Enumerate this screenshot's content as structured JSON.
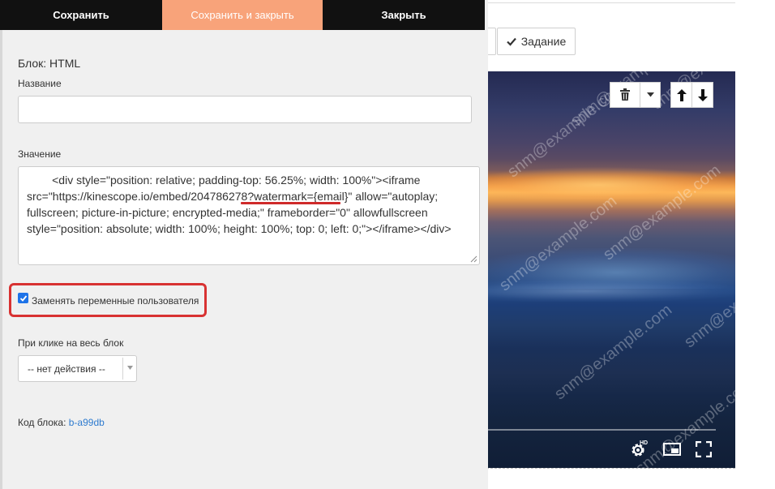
{
  "toolbar": {
    "save_label": "Сохранить",
    "save_close_label": "Сохранить и закрыть",
    "close_label": "Закрыть"
  },
  "block_editor": {
    "block_title": "Блок: HTML",
    "name_label": "Название",
    "name_value": "",
    "value_label": "Значение",
    "value_text": "        <div style=\"position: relative; padding-top: 56.25%; width: 100%\"><iframe src=\"https://kinescope.io/embed/204786278?watermark={email}\" allow=\"autoplay; fullscreen; picture-in-picture; encrypted-media;\" frameborder=\"0\" allowfullscreen style=\"position: absolute; width: 100%; height: 100%; top: 0; left: 0;\"></iframe></div>",
    "replace_vars_label": "Заменять переменные пользователя",
    "replace_vars_checked": true,
    "click_action_label": "При клике на весь блок",
    "click_action_value": "-- нет действия --",
    "block_code_label": "Код блока:",
    "block_code_value": "b-a99db"
  },
  "background_page": {
    "task_button_label": "Задание",
    "video": {
      "watermark_text": "snm@example.com",
      "controls": [
        "delete-icon",
        "caret-down-icon",
        "arrow-up-icon",
        "arrow-down-icon"
      ],
      "player_icons": [
        "settings-hd-icon",
        "pip-icon",
        "fullscreen-icon"
      ]
    }
  },
  "colors": {
    "active_tab": "#f8a37a",
    "dark_tab": "#111111",
    "highlight": "#d83232",
    "link": "#2e7bcf",
    "checkbox": "#1e73e8"
  }
}
